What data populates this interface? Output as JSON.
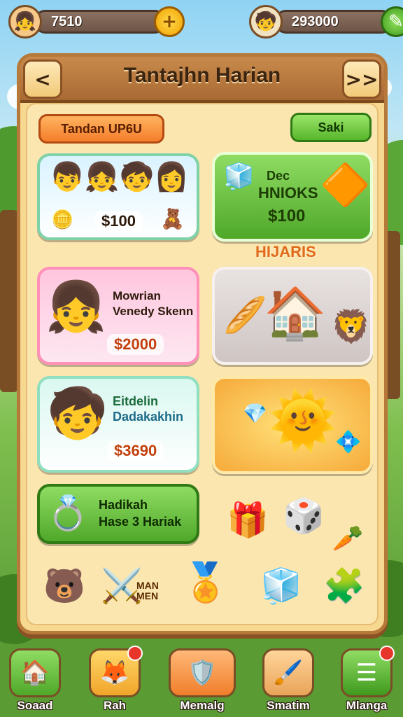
{
  "hud": {
    "left_value": "7510",
    "right_value": "293000",
    "left_avatar_icon": "girl-avatar-icon",
    "right_avatar_icon": "boy-avatar-icon",
    "plus_icon": "plus-icon",
    "pen_icon": "pencil-icon"
  },
  "header": {
    "title": "Tantajhn Harian",
    "back_glyph": "<",
    "forward_glyph": ">>"
  },
  "top_buttons": {
    "left_label": "Tandan UP6U",
    "right_label": "Saki"
  },
  "cards": {
    "kids": {
      "price": "$100"
    },
    "blocks": {
      "line1": "Dec",
      "line2": "HNIOKS",
      "price": "$100"
    },
    "section_label": "HIJARIS",
    "girl": {
      "line1": "Mowrian",
      "line2": "Venedy Skenn",
      "price": "$2000"
    },
    "drink": {
      "line1": "Eitdelin",
      "line2": "Dadakakhin",
      "price": "$3690"
    },
    "reward": {
      "line1": "Hadikah",
      "line2": "Hase 3 Hariak"
    },
    "badge_text": "MAN\nMEN"
  },
  "bottom_nav": [
    {
      "label": "Soaad",
      "icon": "house-icon"
    },
    {
      "label": "Rah",
      "icon": "fox-icon"
    },
    {
      "label": "Memalg",
      "icon": "shield-icon"
    },
    {
      "label": "Smatim",
      "icon": "brush-icon"
    },
    {
      "label": "Mlanga",
      "icon": "menu-icon"
    }
  ],
  "colors": {
    "panel": "#f7d890",
    "header": "#a86a33",
    "accent_orange": "#f47d2b",
    "accent_green": "#57b52b"
  }
}
